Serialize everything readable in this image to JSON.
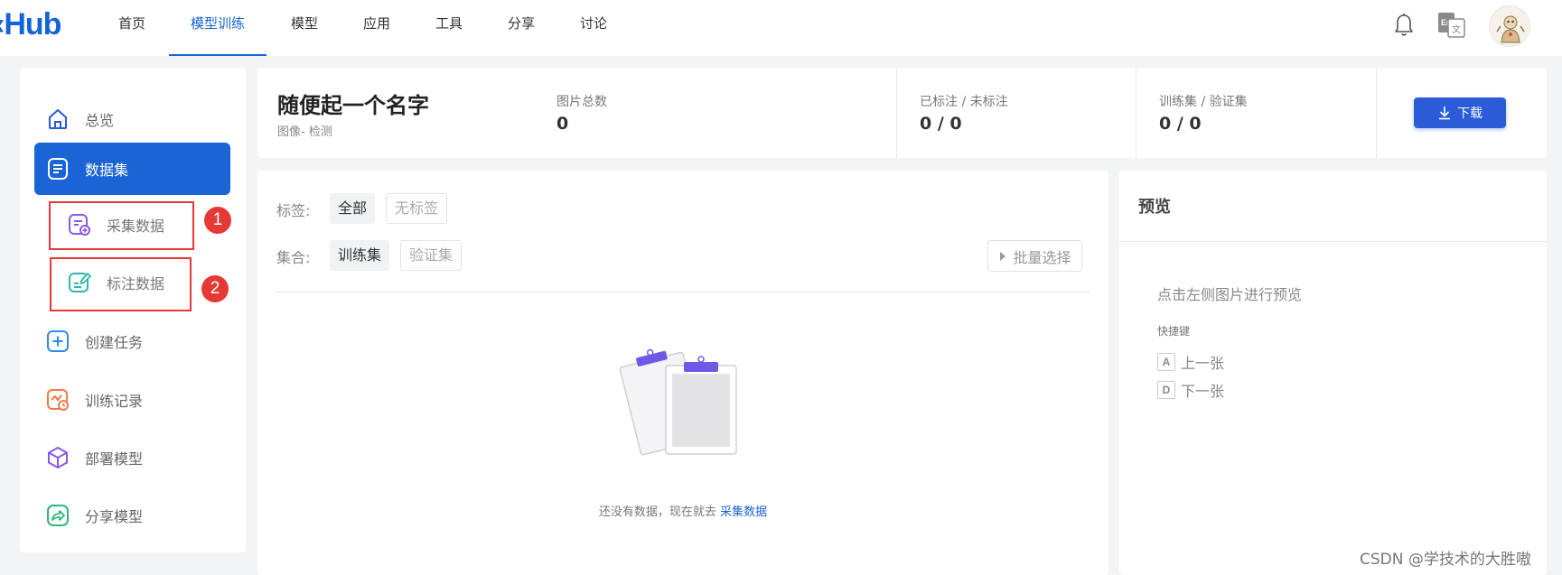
{
  "nav": {
    "logo": "‹Hub",
    "items": [
      "首页",
      "模型训练",
      "模型",
      "应用",
      "工具",
      "分享",
      "讨论"
    ],
    "active_index": 1
  },
  "sidebar": {
    "items": [
      {
        "label": "总览",
        "icon": "home-icon"
      },
      {
        "label": "数据集",
        "icon": "dataset-icon",
        "active": true
      },
      {
        "label": "采集数据",
        "icon": "collect-data-icon",
        "sub": true
      },
      {
        "label": "标注数据",
        "icon": "annotate-data-icon",
        "sub": true
      },
      {
        "label": "创建任务",
        "icon": "plus-square-icon"
      },
      {
        "label": "训练记录",
        "icon": "training-record-icon"
      },
      {
        "label": "部署模型",
        "icon": "cube-icon"
      },
      {
        "label": "分享模型",
        "icon": "share-icon"
      }
    ],
    "annotations": [
      "1",
      "2"
    ]
  },
  "header": {
    "title": "随便起一个名字",
    "subtitle": "图像- 检测",
    "stats": [
      {
        "label": "图片总数",
        "value": "0"
      },
      {
        "label": "已标注 / 未标注",
        "value": "0 / 0"
      },
      {
        "label": "训练集 / 验证集",
        "value": "0 / 0"
      }
    ],
    "download_label": "下载"
  },
  "filters": {
    "tag_label": "标签:",
    "tags": [
      "全部",
      "无标签"
    ],
    "set_label": "集合:",
    "sets": [
      "训练集",
      "验证集"
    ],
    "batch_select_label": "批量选择"
  },
  "empty_state": {
    "text": "还没有数据，现在就去",
    "link": "采集数据"
  },
  "preview": {
    "title": "预览",
    "hint": "点击左侧图片进行预览",
    "shortcut_title": "快捷键",
    "shortcuts": [
      {
        "key": "A",
        "label": "上一张"
      },
      {
        "key": "D",
        "label": "下一张"
      }
    ]
  },
  "colors": {
    "primary": "#1a64d6",
    "button": "#2b5bd7",
    "annotation_red": "#e53935",
    "background": "#f3f4f6"
  },
  "watermark": "CSDN @学技术的大胜嗷"
}
